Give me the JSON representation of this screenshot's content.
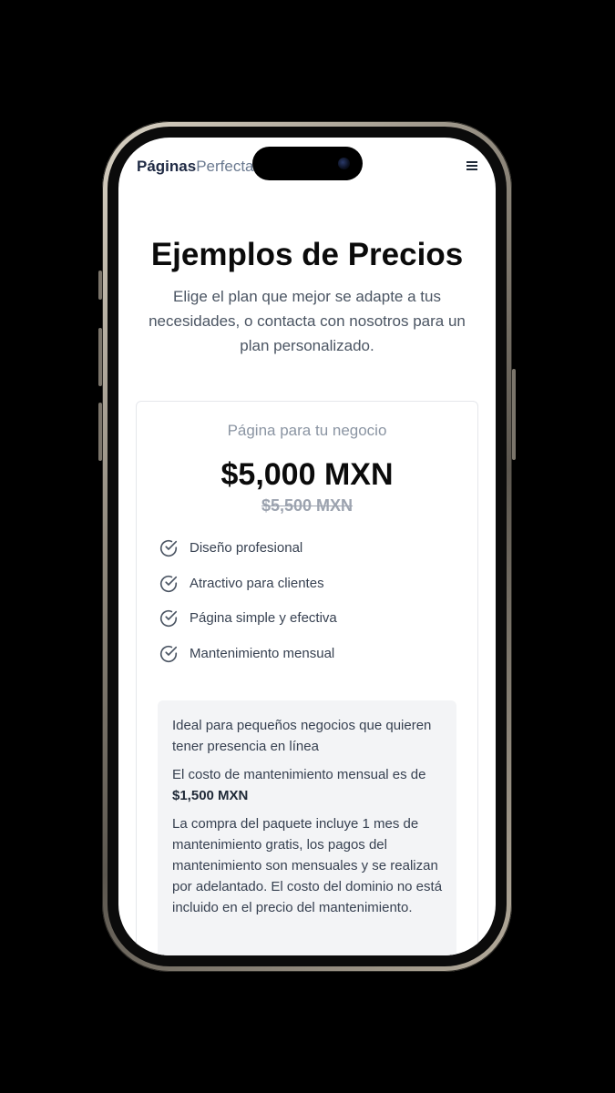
{
  "navbar": {
    "logo_strong": "Páginas",
    "logo_light": "Perfectas"
  },
  "icons": {
    "menu": "hamburger-menu-icon",
    "feature_check": "check-circle-icon"
  },
  "hero": {
    "title": "Ejemplos de Precios",
    "subtitle": "Elige el plan que mejor se adapte a tus necesidades, o contacta con nosotros para un plan personalizado."
  },
  "plan": {
    "name": "Página para tu negocio",
    "price": "$5,000 MXN",
    "old_price": "$5,500 MXN",
    "features": [
      "Diseño profesional",
      "Atractivo para clientes",
      "Página simple y efectiva",
      "Mantenimiento mensual"
    ],
    "info": {
      "ideal": "Ideal para pequeños negocios que quieren tener presencia en línea",
      "maintenance_prefix": "El costo de mantenimiento mensual es de",
      "maintenance_amount": "$1,500 MXN",
      "details": "La compra del paquete incluye 1 mes de mantenimiento gratis, los pagos del mantenimiento son mensuales y se realizan por adelantado. El costo del dominio no está incluido en el precio del mantenimiento."
    }
  },
  "colors": {
    "brand_dark": "#1f2a44",
    "brand_light": "#6b7a90",
    "muted": "#9ca3af",
    "panel": "#f3f4f6"
  }
}
